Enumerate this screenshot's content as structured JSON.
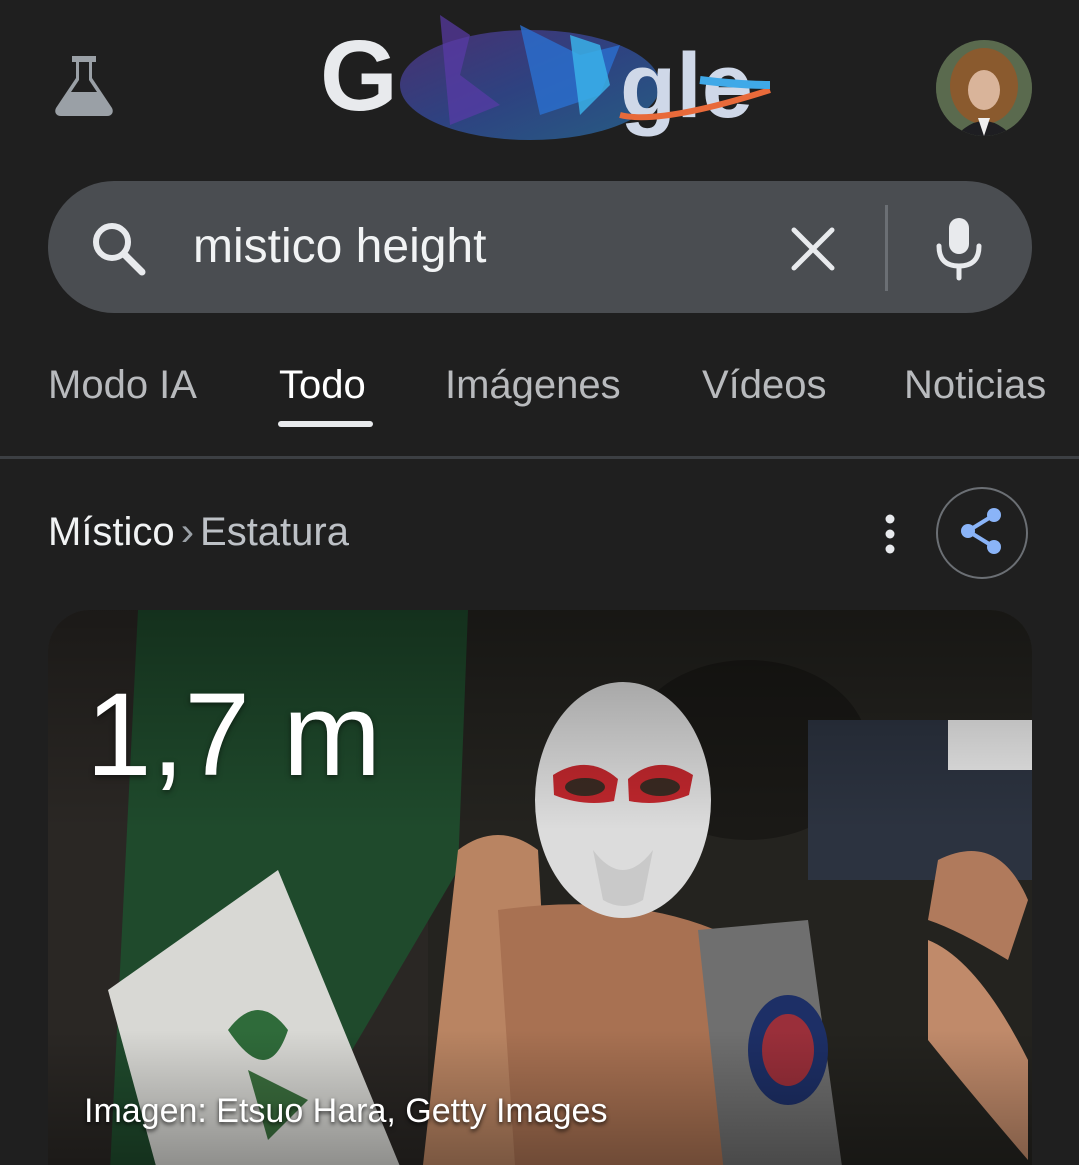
{
  "header": {
    "labs_icon": "flask-icon",
    "logo_text": "Google",
    "doodle_theme": "winter-sports",
    "avatar": "user-avatar"
  },
  "search": {
    "query": "mistico height",
    "search_icon": "search-icon",
    "clear_icon": "close-icon",
    "mic_icon": "microphone-icon"
  },
  "tabs": [
    {
      "label": "Modo IA",
      "active": false
    },
    {
      "label": "Todo",
      "active": true
    },
    {
      "label": "Imágenes",
      "active": false
    },
    {
      "label": "Vídeos",
      "active": false
    },
    {
      "label": "Noticias",
      "active": false
    }
  ],
  "result": {
    "breadcrumb_main": "Místico",
    "breadcrumb_separator": "›",
    "breadcrumb_sub": "Estatura",
    "more_icon": "more-vert-icon",
    "share_icon": "share-icon",
    "height_value": "1,7 m",
    "image_credit": "Imagen: Etsuo Hara, Getty Images"
  },
  "colors": {
    "background": "#1f1f1f",
    "search_bar": "#4a4d51",
    "accent_blue": "#8ab4f8",
    "tab_inactive": "#b8babd",
    "tab_active": "#ffffff"
  }
}
